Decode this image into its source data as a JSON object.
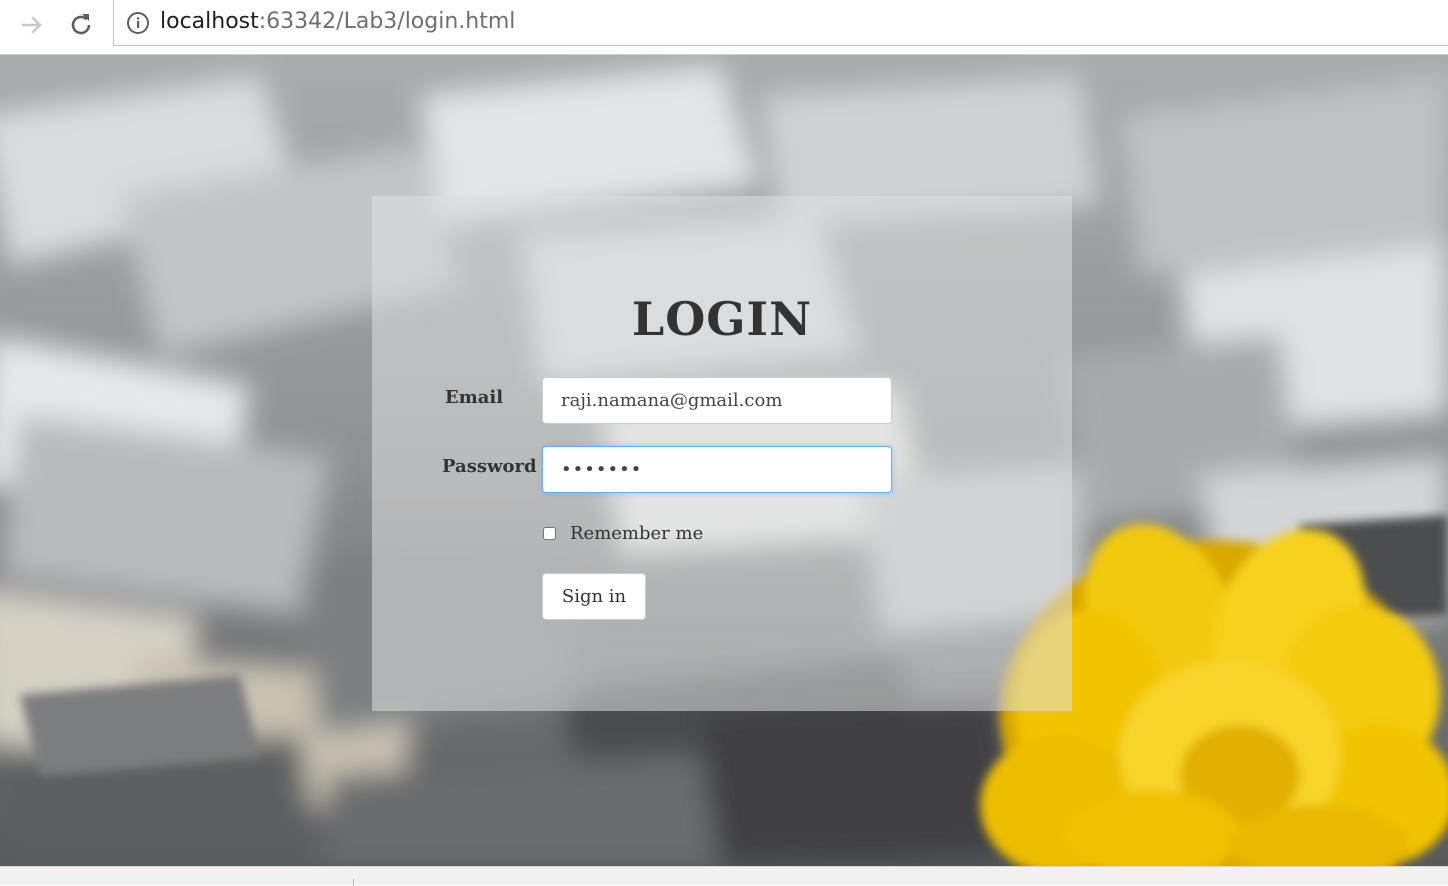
{
  "browser": {
    "url_host": "localhost",
    "url_rest": ":63342/Lab3/login.html",
    "icons": {
      "forward": "arrow-right-icon",
      "reload": "reload-icon",
      "site_info": "info-circle-icon"
    }
  },
  "login": {
    "title": "LOGIN",
    "email_label": "Email",
    "email_value": "raji.namana@gmail.com",
    "password_label": "Password",
    "password_value": "1234567",
    "remember_label": "Remember me",
    "remember_checked": false,
    "signin_label": "Sign in"
  },
  "colors": {
    "card_overlay": "rgba(222,222,222,0.55)",
    "focus_border": "#66afe9",
    "flower_yellow": "#f2c400",
    "text_dark": "#333333"
  }
}
